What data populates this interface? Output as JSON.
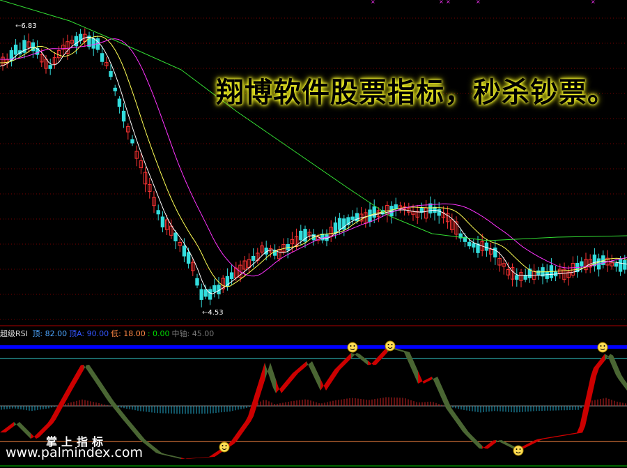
{
  "banner": "翔博软件股票指标，秒杀钞票。",
  "chart_data": {
    "type": "candlestick",
    "price_high_label": "6.83",
    "price_low_label": "4.53",
    "indicator": {
      "name": "超级RSI",
      "params": [
        {
          "label": "顶:",
          "value": "82.00",
          "color": "#4da6ff"
        },
        {
          "label": "顶A:",
          "value": "90.00",
          "color": "#3355ff"
        },
        {
          "label": "低:",
          "value": "18.00",
          "color": "#ff8844"
        },
        {
          "label": ":",
          "value": "0.00",
          "color": "#00dd00"
        },
        {
          "label": "中轴:",
          "value": "45.00",
          "color": "#777777"
        }
      ]
    },
    "colors": {
      "up": "#ff3333",
      "down": "#33dddd",
      "ma1": "#ffffff",
      "ma2": "#ffff55",
      "ma3": "#ff33ff",
      "ma4": "#33dd33",
      "rsi_up": "#cc0000",
      "rsi_down": "#4a6633"
    }
  },
  "watermark": {
    "line1": "掌上指标",
    "line2": "www.palmindex.com"
  }
}
